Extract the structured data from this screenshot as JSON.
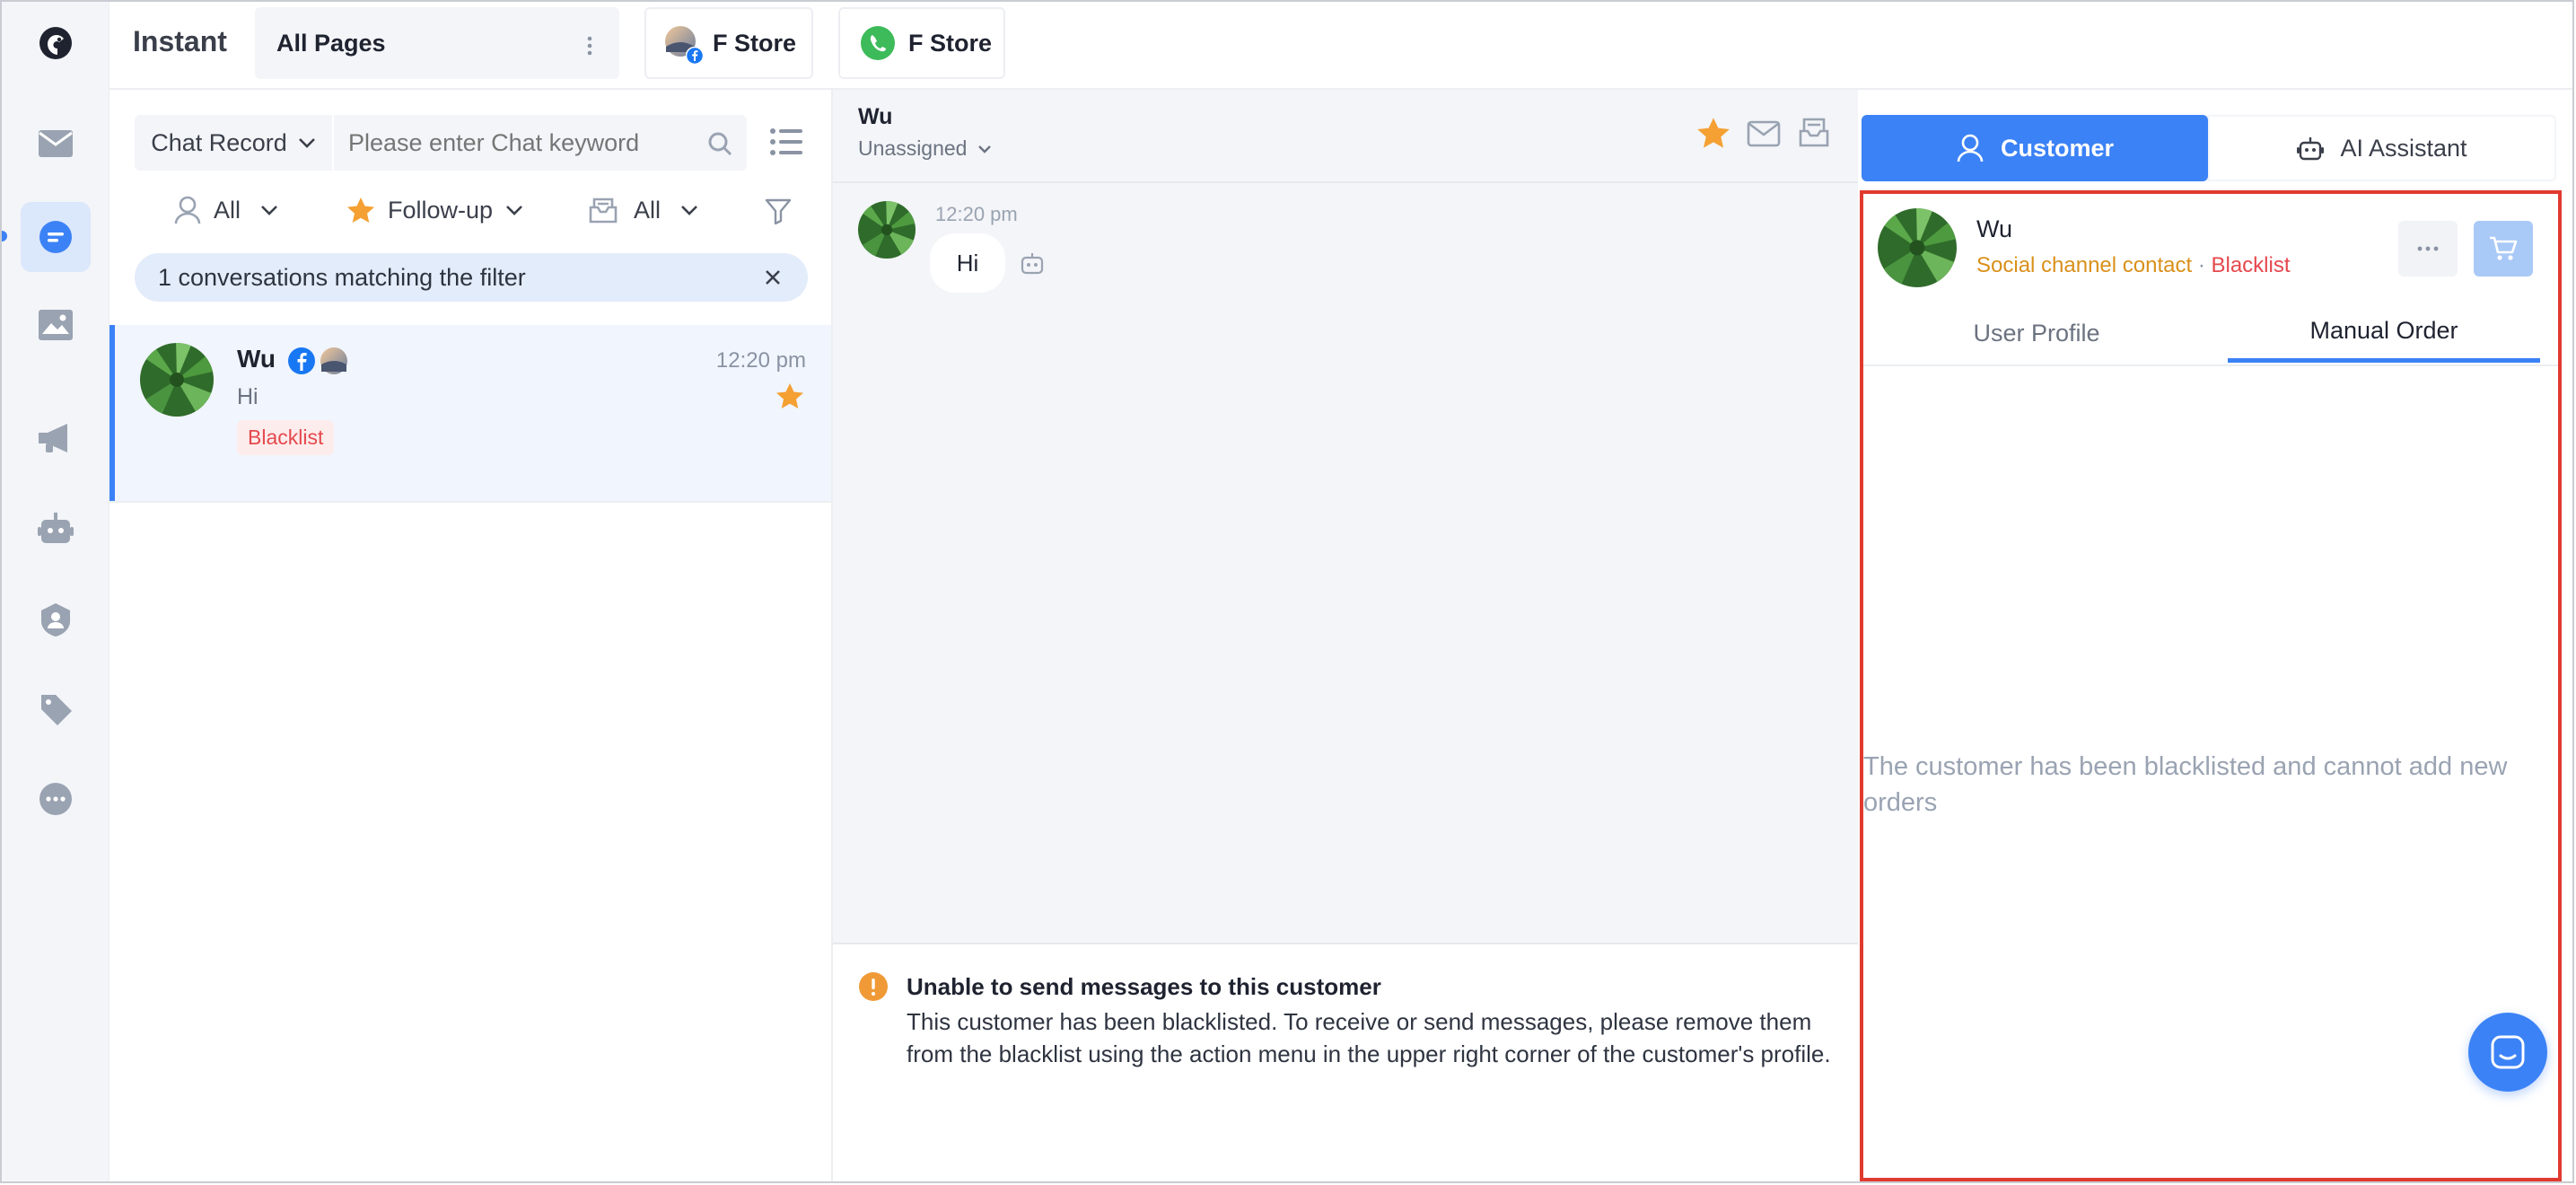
{
  "app": {
    "title": "Instant"
  },
  "topbar": {
    "pages_label": "All Pages",
    "stores": [
      {
        "label": "F Store",
        "channel": "facebook"
      },
      {
        "label": "F Store",
        "channel": "whatsapp"
      }
    ]
  },
  "sidebar": {
    "items": [
      {
        "name": "inbox",
        "icon": "mail-icon"
      },
      {
        "name": "chat",
        "icon": "chat-bubble-icon",
        "active": true
      },
      {
        "name": "media",
        "icon": "image-icon"
      },
      {
        "name": "broadcast",
        "icon": "megaphone-icon"
      },
      {
        "name": "bot",
        "icon": "robot-icon"
      },
      {
        "name": "contacts",
        "icon": "contact-shield-icon"
      },
      {
        "name": "tags",
        "icon": "tag-icon"
      },
      {
        "name": "more",
        "icon": "more-icon"
      }
    ]
  },
  "conversation_list": {
    "search_scope": "Chat Record",
    "search_placeholder": "Please enter Chat keyword",
    "filters": {
      "assignee": "All",
      "follow_up": "Follow-up",
      "inbox": "All"
    },
    "filter_notice": "1 conversations matching the filter",
    "items": [
      {
        "name": "Wu",
        "preview": "Hi",
        "time": "12:20 pm",
        "tag": "Blacklist",
        "starred": true
      }
    ]
  },
  "chat": {
    "contact_name": "Wu",
    "assignment": "Unassigned",
    "messages": [
      {
        "time": "12:20 pm",
        "text": "Hi",
        "sender": "customer"
      }
    ],
    "warning": {
      "title": "Unable to send messages to this customer",
      "body": "This customer has been blacklisted. To receive or send messages, please remove them from the blacklist using the action menu in the upper right corner of the customer's profile."
    }
  },
  "right_panel": {
    "tabs": [
      {
        "label": "Customer",
        "active": true
      },
      {
        "label": "AI Assistant",
        "active": false
      }
    ],
    "customer": {
      "name": "Wu",
      "contact_type": "Social channel contact",
      "separator": " · ",
      "status": "Blacklist"
    },
    "subtabs": [
      {
        "label": "User Profile",
        "active": false
      },
      {
        "label": "Manual Order",
        "active": true
      }
    ],
    "empty_message": "The customer has been blacklisted and cannot add new orders"
  },
  "colors": {
    "accent": "#3b82f6",
    "star": "#f5a033",
    "danger": "#e5484d",
    "warning_orange": "#f09a37",
    "contact_type": "#d9901a",
    "highlight_border": "#e03a2f"
  }
}
